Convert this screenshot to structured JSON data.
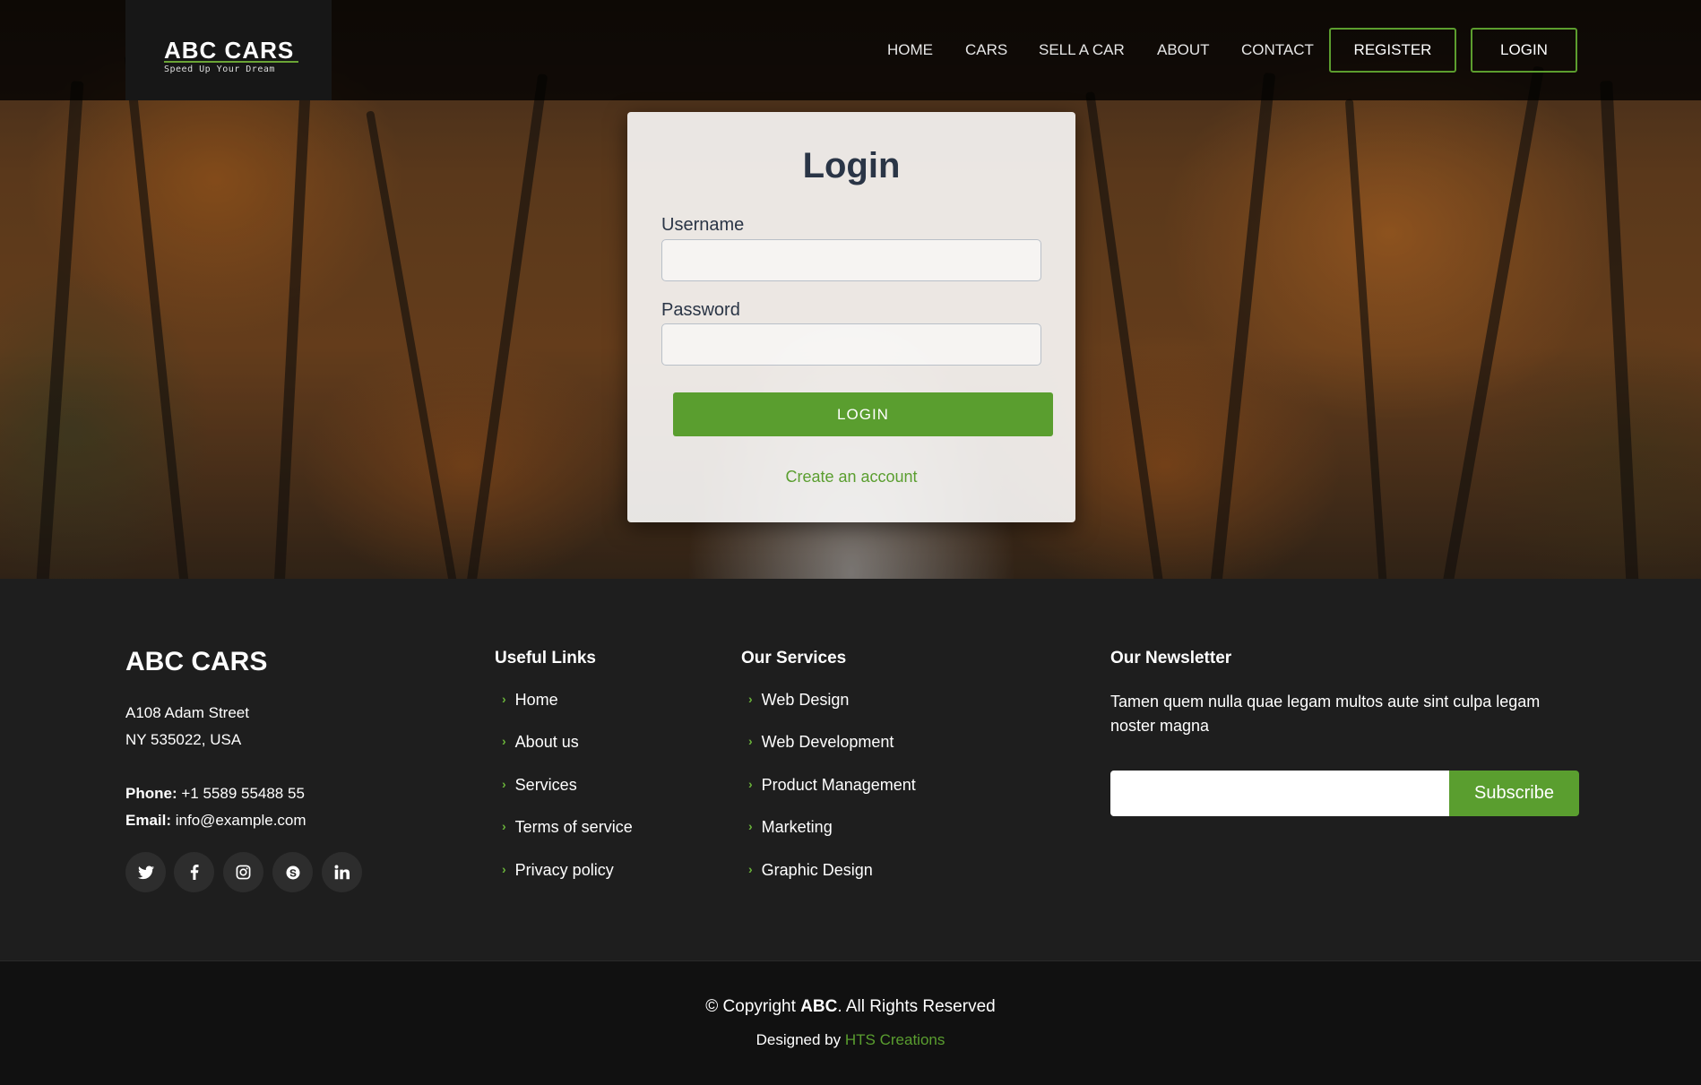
{
  "header": {
    "logo_title": "ABC CARS",
    "logo_tagline": "Speed Up Your Dream",
    "nav": [
      "HOME",
      "CARS",
      "SELL A CAR",
      "ABOUT",
      "CONTACT"
    ],
    "register_label": "REGISTER",
    "login_label": "LOGIN"
  },
  "login_form": {
    "title": "Login",
    "username_label": "Username",
    "username_value": "",
    "password_label": "Password",
    "password_value": "",
    "submit_label": "LOGIN",
    "create_account_link": "Create an account"
  },
  "footer": {
    "brand": "ABC CARS",
    "address_line1": "A108 Adam Street",
    "address_line2": "NY 535022, USA",
    "phone_label": "Phone:",
    "phone_value": "+1 5589 55488 55",
    "email_label": "Email:",
    "email_value": "info@example.com",
    "social_icons": [
      "twitter-icon",
      "facebook-icon",
      "instagram-icon",
      "skype-icon",
      "linkedin-icon"
    ],
    "useful_links_title": "Useful Links",
    "useful_links": [
      "Home",
      "About us",
      "Services",
      "Terms of service",
      "Privacy policy"
    ],
    "services_title": "Our Services",
    "services": [
      "Web Design",
      "Web Development",
      "Product Management",
      "Marketing",
      "Graphic Design"
    ],
    "newsletter_title": "Our Newsletter",
    "newsletter_text": "Tamen quem nulla quae legam multos aute sint culpa legam noster magna",
    "newsletter_input_value": "",
    "subscribe_label": "Subscribe",
    "copyright_prefix": "© Copyright",
    "copyright_brand": "ABC",
    "copyright_suffix": ". All Rights Reserved",
    "designed_prefix": "Designed by",
    "designed_link": "HTS Creations"
  },
  "colors": {
    "accent_green": "#5a9e2f",
    "footer_bg": "#1e1e1e",
    "bottom_bg": "#111111"
  }
}
